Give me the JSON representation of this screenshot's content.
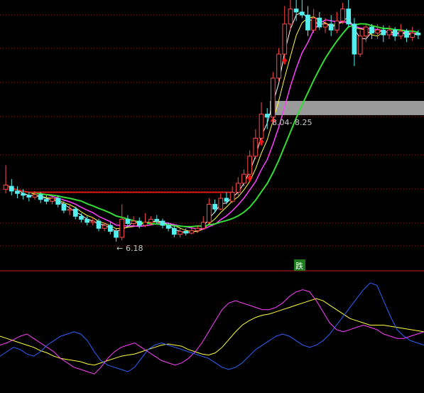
{
  "colors": {
    "background": "#000000",
    "grid": "#8a1a1a",
    "divider": "#a01818",
    "candle_up": "#ff4a4a",
    "candle_down": "#54f0f0",
    "ma_white": "#ffffff",
    "ma_yellow": "#ffff40",
    "ma_magenta": "#ff40ff",
    "ma_green": "#33dd33",
    "ma_red": "#e01818",
    "osc_yellow": "#ffff40",
    "osc_magenta": "#ff40ff",
    "osc_blue": "#3060ff",
    "arrow": "#ff1010",
    "highlight": "#9a9a9a",
    "signal_box": "#1e7a1e"
  },
  "annotations": {
    "low_label": "6.18",
    "range_label": "8.04- 8.25"
  },
  "signal": {
    "label": "跌"
  },
  "chart_data": [
    {
      "type": "candlestick",
      "title": "",
      "ylim": [
        5.8,
        10.2
      ],
      "candles": [
        [
          7.05,
          7.12,
          7.45,
          6.98
        ],
        [
          7.1,
          7.02,
          7.22,
          6.95
        ],
        [
          7.02,
          6.98,
          7.1,
          6.9
        ],
        [
          6.98,
          6.95,
          7.05,
          6.88
        ],
        [
          6.95,
          6.92,
          7.0,
          6.85
        ],
        [
          6.92,
          6.96,
          7.02,
          6.88
        ],
        [
          6.96,
          6.88,
          7.0,
          6.82
        ],
        [
          6.88,
          6.85,
          6.95,
          6.8
        ],
        [
          6.85,
          6.9,
          6.95,
          6.8
        ],
        [
          6.9,
          6.8,
          6.95,
          6.75
        ],
        [
          6.8,
          6.7,
          6.85,
          6.65
        ],
        [
          6.7,
          6.72,
          6.78,
          6.62
        ],
        [
          6.72,
          6.6,
          6.76,
          6.55
        ],
        [
          6.6,
          6.55,
          6.65,
          6.5
        ],
        [
          6.55,
          6.5,
          6.6,
          6.45
        ],
        [
          6.5,
          6.52,
          6.58,
          6.45
        ],
        [
          6.52,
          6.4,
          6.56,
          6.35
        ],
        [
          6.4,
          6.45,
          6.5,
          6.35
        ],
        [
          6.45,
          6.35,
          6.5,
          6.3
        ],
        [
          6.35,
          6.25,
          6.4,
          6.18
        ],
        [
          6.25,
          6.55,
          6.8,
          6.2
        ],
        [
          6.55,
          6.48,
          6.62,
          6.42
        ],
        [
          6.48,
          6.52,
          6.6,
          6.44
        ],
        [
          6.52,
          6.45,
          6.58,
          6.4
        ],
        [
          6.45,
          6.5,
          6.65,
          6.42
        ],
        [
          6.5,
          6.55,
          6.6,
          6.45
        ],
        [
          6.55,
          6.52,
          6.62,
          6.48
        ],
        [
          6.52,
          6.45,
          6.56,
          6.4
        ],
        [
          6.45,
          6.4,
          6.5,
          6.35
        ],
        [
          6.4,
          6.3,
          6.45,
          6.25
        ],
        [
          6.3,
          6.35,
          6.4,
          6.25
        ],
        [
          6.35,
          6.32,
          6.4,
          6.28
        ],
        [
          6.32,
          6.36,
          6.42,
          6.3
        ],
        [
          6.36,
          6.4,
          6.45,
          6.32
        ],
        [
          6.4,
          6.5,
          6.6,
          6.38
        ],
        [
          6.5,
          6.8,
          6.9,
          6.48
        ],
        [
          6.8,
          6.72,
          6.88,
          6.66
        ],
        [
          6.72,
          6.9,
          6.98,
          6.7
        ],
        [
          6.9,
          6.85,
          7.0,
          6.8
        ],
        [
          6.85,
          7.0,
          7.1,
          6.82
        ],
        [
          7.0,
          7.15,
          7.25,
          6.95
        ],
        [
          7.15,
          7.3,
          7.38,
          7.1
        ],
        [
          7.3,
          7.6,
          7.7,
          7.25
        ],
        [
          7.6,
          7.9,
          8.05,
          7.55
        ],
        [
          7.9,
          8.3,
          8.5,
          7.85
        ],
        [
          8.3,
          8.25,
          8.4,
          8.05
        ],
        [
          8.25,
          8.9,
          9.0,
          8.2
        ],
        [
          8.9,
          9.3,
          9.4,
          8.85
        ],
        [
          9.3,
          9.8,
          10.1,
          9.2
        ],
        [
          9.8,
          10.05,
          10.25,
          9.7
        ],
        [
          10.05,
          10.0,
          10.3,
          9.85
        ],
        [
          10.0,
          9.95,
          10.4,
          9.9
        ],
        [
          9.95,
          9.7,
          10.1,
          9.6
        ],
        [
          9.7,
          9.9,
          10.05,
          9.65
        ],
        [
          9.9,
          9.75,
          10.0,
          9.7
        ],
        [
          9.75,
          9.8,
          9.9,
          9.65
        ],
        [
          9.8,
          9.7,
          9.95,
          9.6
        ],
        [
          9.7,
          9.85,
          10.0,
          9.65
        ],
        [
          9.85,
          10.05,
          10.15,
          9.8
        ],
        [
          10.05,
          9.8,
          10.2,
          9.75
        ],
        [
          9.8,
          9.3,
          9.9,
          9.1
        ],
        [
          9.3,
          9.6,
          9.7,
          9.25
        ],
        [
          9.6,
          9.75,
          9.8,
          9.5
        ],
        [
          9.75,
          9.65,
          9.8,
          9.55
        ],
        [
          9.65,
          9.7,
          9.8,
          9.55
        ],
        [
          9.7,
          9.62,
          9.78,
          9.5
        ],
        [
          9.62,
          9.7,
          9.78,
          9.55
        ],
        [
          9.7,
          9.6,
          9.75,
          9.52
        ],
        [
          9.6,
          9.68,
          9.8,
          9.55
        ],
        [
          9.68,
          9.58,
          9.72,
          9.5
        ],
        [
          9.58,
          9.65,
          9.75,
          9.52
        ],
        [
          9.65,
          9.62,
          9.7,
          9.55
        ]
      ],
      "arrows_at": [
        48,
        46,
        44,
        42
      ]
    },
    {
      "type": "line",
      "title": "",
      "ylim": [
        0,
        100
      ],
      "series": [
        {
          "color_key": "osc_yellow",
          "values": [
            48,
            46,
            44,
            42,
            40,
            38,
            35,
            33,
            30,
            28,
            27,
            26,
            25,
            23,
            22,
            24,
            26,
            28,
            30,
            31,
            32,
            34,
            36,
            38,
            40,
            41,
            40,
            39,
            36,
            34,
            32,
            31,
            33,
            38,
            45,
            52,
            58,
            62,
            65,
            67,
            68,
            70,
            72,
            74,
            76,
            78,
            80,
            82,
            80,
            76,
            72,
            68,
            64,
            62,
            60,
            58,
            58,
            58,
            57,
            56,
            55,
            54,
            53,
            52
          ]
        },
        {
          "color_key": "osc_magenta",
          "values": [
            40,
            42,
            45,
            48,
            50,
            46,
            42,
            38,
            34,
            28,
            24,
            20,
            18,
            16,
            14,
            20,
            28,
            34,
            38,
            40,
            42,
            38,
            34,
            30,
            26,
            24,
            22,
            24,
            28,
            34,
            42,
            52,
            62,
            72,
            78,
            80,
            78,
            76,
            74,
            72,
            72,
            74,
            78,
            84,
            88,
            90,
            88,
            80,
            70,
            60,
            54,
            52,
            54,
            56,
            58,
            56,
            54,
            50,
            48,
            46,
            46,
            48,
            50,
            52
          ]
        },
        {
          "color_key": "osc_blue",
          "values": [
            30,
            34,
            38,
            36,
            32,
            30,
            34,
            40,
            44,
            48,
            50,
            52,
            50,
            44,
            34,
            26,
            22,
            20,
            18,
            16,
            20,
            28,
            36,
            40,
            42,
            40,
            38,
            36,
            34,
            32,
            30,
            28,
            24,
            20,
            18,
            20,
            24,
            30,
            36,
            40,
            44,
            48,
            50,
            48,
            44,
            40,
            38,
            40,
            44,
            50,
            58,
            66,
            74,
            82,
            90,
            96,
            94,
            80,
            66,
            54,
            48,
            44,
            42,
            40
          ]
        }
      ]
    }
  ]
}
